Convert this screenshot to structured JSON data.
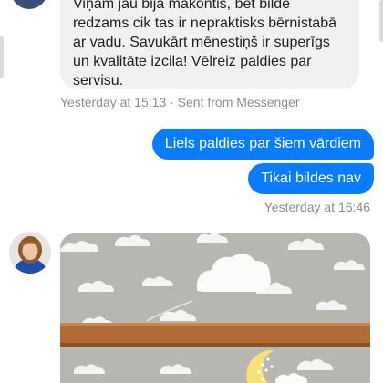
{
  "incoming_message": {
    "lines": [
      "Viņam jau bija makontis, bet bilde",
      "redzams cik tas ir nepraktisks bērnistabā",
      "ar vadu. Savukārt mēnestiņš ir superīgs",
      "un kvalitāte izcila! Vēlreiz paldies par",
      "servisu."
    ],
    "timestamp": "Yesterday at 15:13 · Sent from Messenger"
  },
  "outgoing_messages": [
    {
      "text": "Liels paldies par šiem vārdiem"
    },
    {
      "text": "Tikai bildes nav"
    }
  ],
  "outgoing_timestamp": "Yesterday at 16:46",
  "colors": {
    "outgoing_bubble": "#0a7cff",
    "incoming_bubble": "#f0f1f3",
    "timestamp_text": "#8a8d91",
    "wall": "#b7b6b1",
    "shelf": "#b26a36",
    "moon_lamp": "#f6e07a"
  },
  "icons": {
    "sender_avatar": "avatar",
    "photo_attachment": "image"
  }
}
